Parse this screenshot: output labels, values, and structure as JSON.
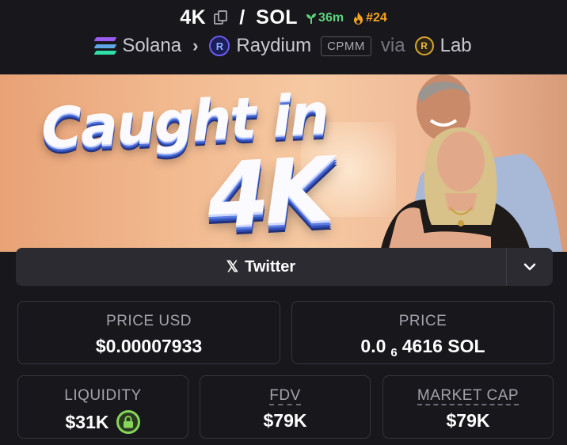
{
  "header": {
    "base_symbol": "4K",
    "separator": "/",
    "quote_symbol": "SOL",
    "age": "36m",
    "rank": "#24",
    "chain": "Solana",
    "dex": "Raydium",
    "pool_type": "CPMM",
    "via_label": "via",
    "launchpad": "Lab"
  },
  "banner": {
    "line1": "Caught in",
    "line2": "4K"
  },
  "links": {
    "twitter_label": "Twitter"
  },
  "stats": {
    "price_usd_label": "PRICE USD",
    "price_usd_value": "$0.00007933",
    "price_label": "PRICE",
    "price_prefix": "0.0",
    "price_zero_count": "6",
    "price_suffix": "4616 SOL",
    "liquidity_label": "LIQUIDITY",
    "liquidity_value": "$31K",
    "fdv_label": "FDV",
    "fdv_value": "$79K",
    "market_cap_label": "MARKET CAP",
    "market_cap_value": "$79K"
  },
  "colors": {
    "background": "#17171c",
    "age_green": "#5fd27a",
    "rank_orange": "#f5a524",
    "lock_green": "#86d65a"
  },
  "icons": [
    "copy-icon",
    "sprout-icon",
    "flame-icon",
    "solana-logo",
    "raydium-logo",
    "launchlab-logo",
    "x-logo-icon",
    "chevron-down-icon",
    "lock-icon"
  ]
}
